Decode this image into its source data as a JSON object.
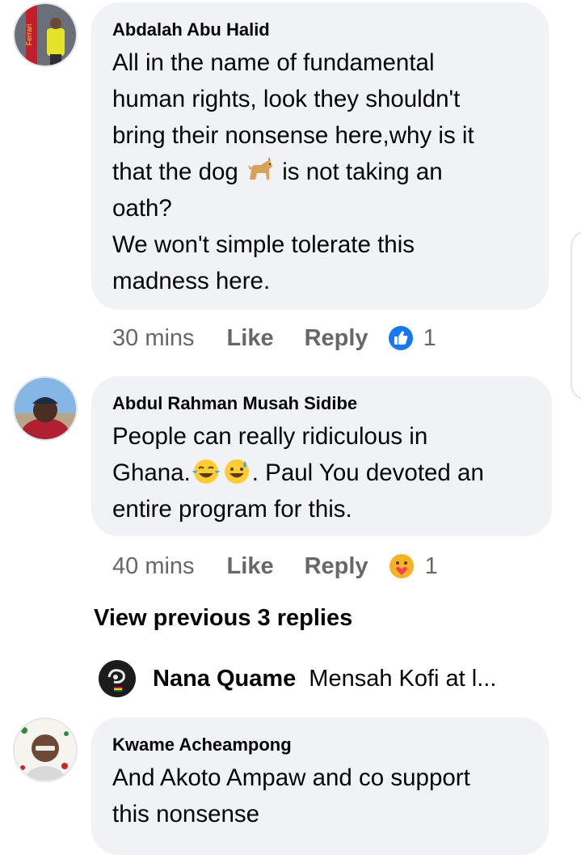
{
  "comments": [
    {
      "author": "Abdalah Abu Halid",
      "text_part1": "All in the name of fundamental\nhuman rights, look they shouldn't\nbring their nonsense here,why is it\nthat the dog ",
      "emoji": "dog",
      "text_part2": " is not taking an\noath?\nWe won't simple tolerate this\nmadness here.",
      "time": "30 mins",
      "like_label": "Like",
      "reply_label": "Reply",
      "reaction": "like-reaction",
      "reaction_count": "1"
    },
    {
      "author": "Abdul Rahman Musah Sidibe",
      "text_part1": "People can really ridiculous in\nGhana.",
      "emojis": [
        "face-with-tears-of-joy",
        "grinning-face-with-sweat"
      ],
      "text_part2": ". Paul You devoted an\nentire program for this.",
      "time": "40 mins",
      "like_label": "Like",
      "reply_label": "Reply",
      "reaction": "care-reaction",
      "reaction_count": "1"
    },
    {
      "author": "Kwame Acheampong",
      "text": "And Akoto Ampaw and co support\nthis nonsense"
    }
  ],
  "view_previous": "View previous 3 replies",
  "reply_preview": {
    "name": "Nana Quame",
    "text": "Mensah Kofi at l..."
  }
}
